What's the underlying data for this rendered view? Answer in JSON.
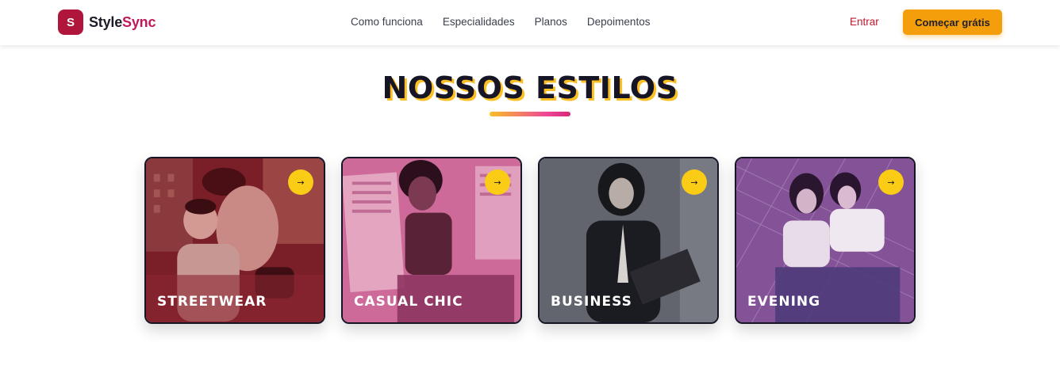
{
  "brand": {
    "badge": "S",
    "name_part1": "Style",
    "name_part2": "Sync"
  },
  "nav": {
    "items": [
      {
        "label": "Como funciona"
      },
      {
        "label": "Especialidades"
      },
      {
        "label": "Planos"
      },
      {
        "label": "Depoimentos"
      }
    ],
    "login_label": "Entrar",
    "cta_label": "Começar grátis"
  },
  "section": {
    "title": "NOSSOS ESTILOS"
  },
  "cards": [
    {
      "label": "STREETWEAR",
      "arrow": "→"
    },
    {
      "label": "CASUAL CHIC",
      "arrow": "→"
    },
    {
      "label": "BUSINESS",
      "arrow": "→"
    },
    {
      "label": "EVENING",
      "arrow": "→"
    }
  ],
  "colors": {
    "brand_red": "#b0163b",
    "brand_pink": "#c2185b",
    "accent_yellow": "#facc15",
    "cta_orange": "#f59e0b",
    "login_red": "#c0182c"
  }
}
